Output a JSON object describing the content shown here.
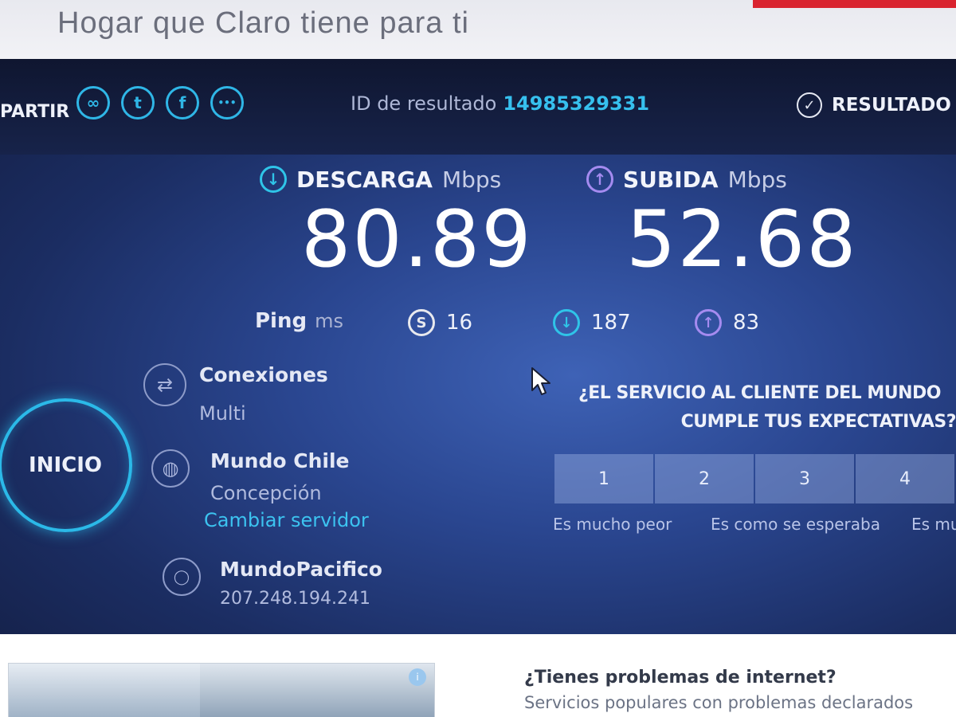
{
  "banner": {
    "text": "Hogar que Claro tiene para ti"
  },
  "header": {
    "share_label": "PARTIR",
    "share_icons": [
      "link-icon",
      "twitter-icon",
      "facebook-icon",
      "more-icon"
    ],
    "share_glyphs": [
      "∞",
      "t",
      "f",
      "•••"
    ],
    "result_id_label": "ID de resultado",
    "result_id_value": "14985329331",
    "results_label": "RESULTADO",
    "results_glyph": "✓"
  },
  "download": {
    "label": "DESCARGA",
    "unit": "Mbps",
    "value": "80.89",
    "glyph": "↓",
    "color": "#2fc4e8"
  },
  "upload": {
    "label": "SUBIDA",
    "unit": "Mbps",
    "value": "52.68",
    "glyph": "↑",
    "color": "#a58bf0"
  },
  "ping": {
    "label": "Ping",
    "unit": "ms",
    "idle_value": "16",
    "idle_glyph": "S",
    "download_value": "187",
    "download_glyph": "↓",
    "upload_value": "83",
    "upload_glyph": "↑"
  },
  "start": {
    "label": "INICIO"
  },
  "connections": {
    "title": "Conexiones",
    "value": "Multi",
    "glyph": "⇄"
  },
  "server": {
    "title": "Mundo Chile",
    "location": "Concepción",
    "change_link": "Cambiar servidor",
    "glyph": "◍"
  },
  "provider": {
    "title": "MundoPacifico",
    "ip": "207.248.194.241",
    "glyph": "◯"
  },
  "survey": {
    "question_line1": "¿EL SERVICIO AL CLIENTE DEL MUNDO",
    "question_line2": "CUMPLE TUS EXPECTATIVAS?",
    "ratings": [
      "1",
      "2",
      "3",
      "4"
    ],
    "caption_low": "Es mucho peor",
    "caption_mid": "Es como se esperaba",
    "caption_high": "Es mu"
  },
  "footer": {
    "problems_title": "¿Tienes problemas de internet?",
    "problems_sub": "Servicios populares con problemas declarados"
  }
}
